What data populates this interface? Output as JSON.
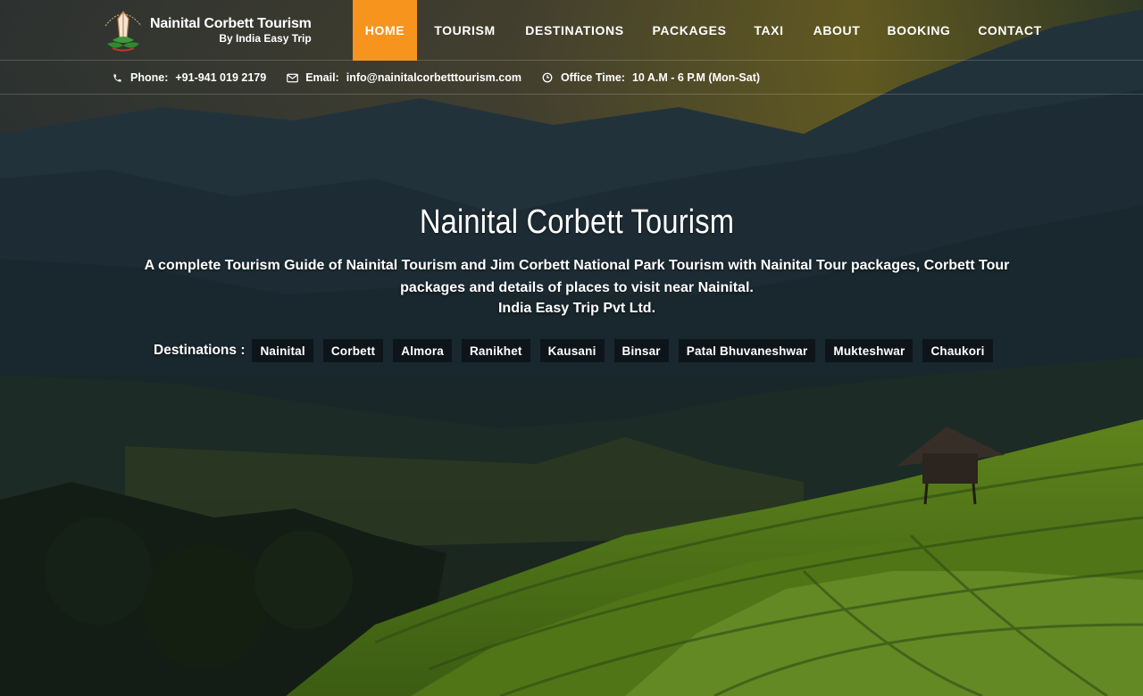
{
  "brand": {
    "title": "Nainital Corbett Tourism",
    "subtitle": "By India Easy Trip"
  },
  "nav": {
    "items": [
      {
        "label": "HOME",
        "active": true
      },
      {
        "label": "TOURISM"
      },
      {
        "label": "DESTINATIONS"
      },
      {
        "label": "PACKAGES"
      },
      {
        "label": "TAXI"
      },
      {
        "label": "ABOUT"
      },
      {
        "label": "BOOKING"
      },
      {
        "label": "CONTACT"
      }
    ]
  },
  "contact": {
    "phone_label": "Phone:",
    "phone": "+91-941 019 2179",
    "email_label": "Email:",
    "email": "info@nainitalcorbetttourism.com",
    "office_label": "Office Time:",
    "office": "10 A.M - 6 P.M (Mon-Sat)"
  },
  "hero": {
    "title": "Nainital Corbett Tourism",
    "description": "A complete Tourism Guide of Nainital Tourism and Jim Corbett National Park Tourism with Nainital Tour packages, Corbett Tour packages and details of places to visit near Nainital.",
    "company": "India Easy Trip Pvt Ltd.",
    "destinations_label": "Destinations :",
    "destinations": [
      "Nainital",
      "Corbett",
      "Almora",
      "Ranikhet",
      "Kausani",
      "Binsar",
      "Patal Bhuvaneshwar",
      "Mukteshwar",
      "Chaukori"
    ]
  },
  "colors": {
    "accent": "#f7941d",
    "chip_bg": "#0e161c"
  },
  "icons": {
    "phone": "phone-icon",
    "email": "envelope-icon",
    "office": "clock-icon"
  }
}
